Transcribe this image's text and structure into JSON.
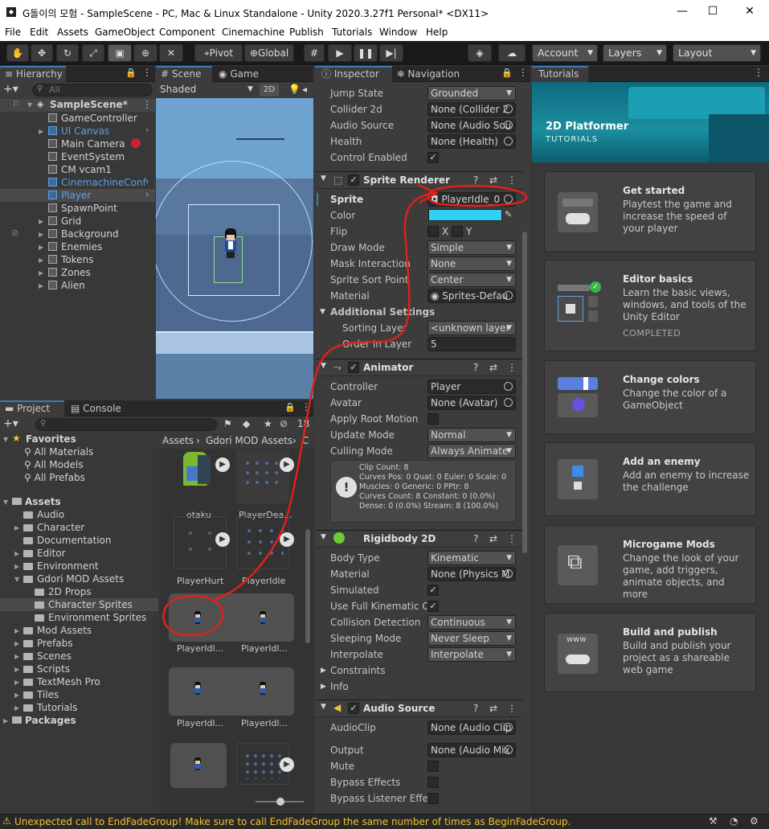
{
  "window": {
    "title": "G돌이의 모험 - SampleScene - PC, Mac & Linux Standalone - Unity 2020.3.27f1 Personal* <DX11>"
  },
  "menu": [
    "File",
    "Edit",
    "Assets",
    "GameObject",
    "Component",
    "Cinemachine",
    "Publish",
    "Tutorials",
    "Window",
    "Help"
  ],
  "toolbar": {
    "pivot": "Pivot",
    "global": "Global",
    "account": "Account",
    "layers": "Layers",
    "layout": "Layout"
  },
  "hierarchy": {
    "tab": "Hierarchy",
    "search_placeholder": "All",
    "scene": "SampleScene*",
    "items": [
      "GameController",
      "UI Canvas",
      "Main Camera",
      "EventSystem",
      "CM vcam1",
      "CinemachineConf",
      "Player",
      "SpawnPoint",
      "Grid",
      "Background",
      "Enemies",
      "Tokens",
      "Zones",
      "Alien"
    ]
  },
  "scene_view": {
    "tab_scene": "Scene",
    "tab_game": "Game",
    "shading": "Shaded",
    "mode_2d": "2D"
  },
  "project": {
    "tab_project": "Project",
    "tab_console": "Console",
    "hidden_count": "18",
    "favorites": "Favorites",
    "fav_items": [
      "All Materials",
      "All Models",
      "All Prefabs"
    ],
    "assets": "Assets",
    "folders": [
      "Audio",
      "Character",
      "Documentation",
      "Editor",
      "Environment",
      "Gdori MOD Assets",
      "2D Props",
      "Character Sprites",
      "Environment Sprites",
      "Mod Assets",
      "Prefabs",
      "Scenes",
      "Scripts",
      "TextMesh Pro",
      "Tiles",
      "Tutorials"
    ],
    "packages": "Packages",
    "breadcrumb": [
      "Assets",
      "Gdori MOD Assets",
      "C"
    ],
    "asset_labels": [
      "otaku",
      "PlayerDea...",
      "PlayerHurt",
      "PlayerIdle",
      "PlayerIdl...",
      "PlayerIdl...",
      "PlayerIdl...",
      "PlayerIdl..."
    ]
  },
  "inspector": {
    "tab_inspector": "Inspector",
    "tab_navigation": "Navigation",
    "top_props": [
      {
        "label": "Jump State",
        "value": "Grounded"
      },
      {
        "label": "Collider 2d",
        "value": "None (Collider 2"
      },
      {
        "label": "Audio Source",
        "value": "None (Audio Sou"
      },
      {
        "label": "Health",
        "value": "None (Health)"
      },
      {
        "label": "Control Enabled",
        "value": "✓"
      }
    ],
    "sprite_renderer": {
      "name": "Sprite Renderer",
      "sprite_label": "Sprite",
      "sprite_value": "PlayerIdle_0",
      "color_label": "Color",
      "color": "#2fd0f0",
      "flip_label": "Flip",
      "flip_x": "X",
      "flip_y": "Y",
      "rows": [
        {
          "label": "Draw Mode",
          "value": "Simple"
        },
        {
          "label": "Mask Interaction",
          "value": "None"
        },
        {
          "label": "Sprite Sort Point",
          "value": "Center"
        },
        {
          "label": "Material",
          "value": "Sprites-Defau"
        }
      ],
      "additional": "Additional Settings",
      "sorting_layer_label": "Sorting Layer",
      "sorting_layer": "<unknown layer",
      "order_label": "Order in Layer",
      "order": "5"
    },
    "animator": {
      "name": "Animator",
      "rows": [
        {
          "label": "Controller",
          "value": "Player"
        },
        {
          "label": "Avatar",
          "value": "None (Avatar)"
        },
        {
          "label": "Apply Root Motion",
          "value": ""
        },
        {
          "label": "Update Mode",
          "value": "Normal"
        },
        {
          "label": "Culling Mode",
          "value": "Always Animate"
        }
      ],
      "info": [
        "Clip Count: 8",
        "Curves Pos: 0 Quat: 0 Euler: 0 Scale: 0",
        "Muscles: 0 Generic: 0 PPtr: 8",
        "Curves Count: 8 Constant: 0 (0.0%)",
        "Dense: 0 (0.0%) Stream: 8 (100.0%)"
      ]
    },
    "rigidbody": {
      "name": "Rigidbody 2D",
      "rows": [
        {
          "label": "Body Type",
          "value": "Kinematic"
        },
        {
          "label": "Material",
          "value": "None (Physics M"
        },
        {
          "label": "Simulated",
          "value": "✓"
        },
        {
          "label": "Use Full Kinematic Co",
          "value": "✓"
        },
        {
          "label": "Collision Detection",
          "value": "Continuous"
        },
        {
          "label": "Sleeping Mode",
          "value": "Never Sleep"
        },
        {
          "label": "Interpolate",
          "value": "Interpolate"
        }
      ],
      "constraints": "Constraints",
      "info": "Info"
    },
    "audio": {
      "name": "Audio Source",
      "rows": [
        {
          "label": "AudioClip",
          "value": "None (Audio Clip"
        },
        {
          "label": "Output",
          "value": "None (Audio Mix"
        },
        {
          "label": "Mute",
          "value": ""
        },
        {
          "label": "Bypass Effects",
          "value": ""
        },
        {
          "label": "Bypass Listener Effec",
          "value": ""
        }
      ]
    }
  },
  "tutorials": {
    "tab": "Tutorials",
    "banner_title": "2D Platformer",
    "banner_sub": "TUTORIALS",
    "cards": [
      {
        "title": "Get started",
        "desc": "Playtest the game and increase the speed of your player",
        "status": ""
      },
      {
        "title": "Editor basics",
        "desc": "Learn the basic views, windows, and tools of the Unity Editor",
        "status": "COMPLETED"
      },
      {
        "title": "Change colors",
        "desc": "Change the color of a GameObject",
        "status": ""
      },
      {
        "title": "Add an enemy",
        "desc": "Add an enemy to increase the challenge",
        "status": ""
      },
      {
        "title": "Microgame Mods",
        "desc": "Change the look of your game, add triggers, animate objects, and more",
        "status": ""
      },
      {
        "title": "Build and publish",
        "desc": "Build and publish your project as a shareable web game",
        "status": ""
      }
    ],
    "www": "www"
  },
  "status": {
    "message": "Unexpected call to EndFadeGroup! Make sure to call EndFadeGroup the same number of times as BeginFadeGroup."
  },
  "colors": {
    "accent": "#3a79bb",
    "annotation": "#e0201c",
    "warning": "#f2c230",
    "selected_text": "#5ca0e8"
  }
}
